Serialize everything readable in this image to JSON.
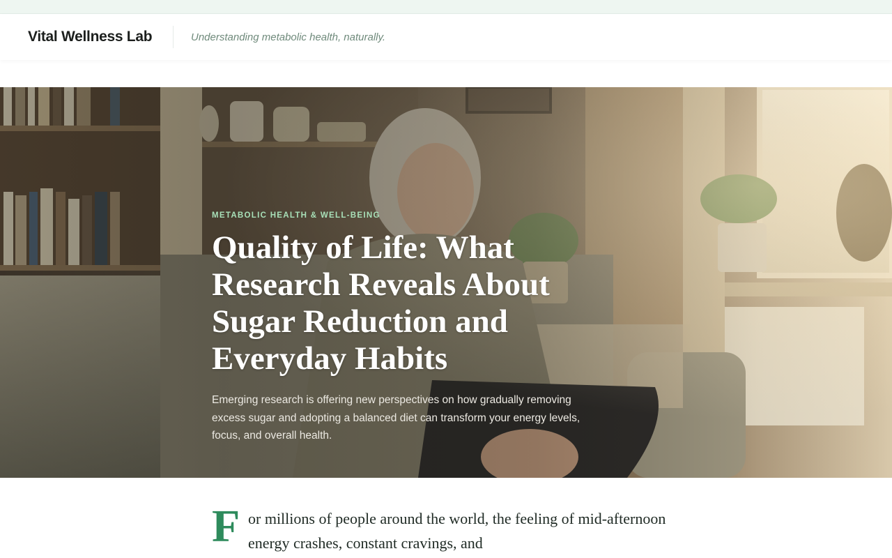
{
  "site": {
    "brand": "Vital Wellness Lab",
    "tagline": "Understanding metabolic health, naturally."
  },
  "hero": {
    "eyebrow": "METABOLIC HEALTH & WELL-BEING",
    "title": "Quality of Life: What Research Reveals About Sugar Reduction and Everyday Habits",
    "dek": "Emerging research is offering new perspectives on how gradually removing excess sugar and adopting a balanced diet can transform your energy levels, focus, and overall health."
  },
  "article": {
    "dropcap": "F",
    "lede": "or millions of people around the world, the feeling of mid-afternoon energy crashes, constant cravings, and"
  },
  "colors": {
    "accent": "#2e8b5c",
    "eyebrow": "#a8e0b8",
    "topbar": "#eef6f1"
  }
}
